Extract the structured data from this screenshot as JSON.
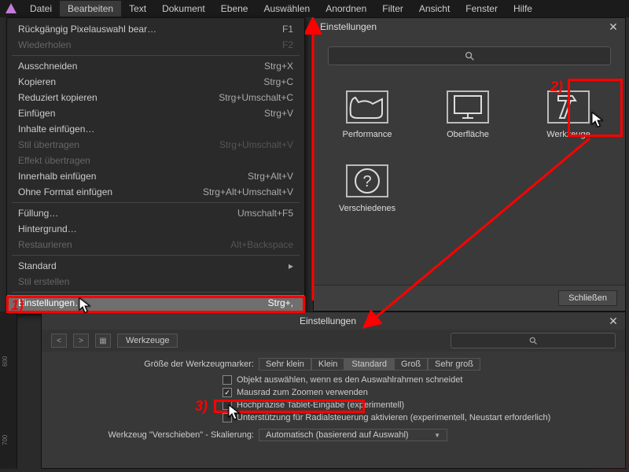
{
  "menubar": {
    "items": [
      "Datei",
      "Bearbeiten",
      "Text",
      "Dokument",
      "Ebene",
      "Auswählen",
      "Anordnen",
      "Filter",
      "Ansicht",
      "Fenster",
      "Hilfe"
    ],
    "active_index": 1
  },
  "dropdown": {
    "rows": [
      {
        "label": "Rückgängig Pixelauswahl bear…",
        "shortcut": "F1"
      },
      {
        "label": "Wiederholen",
        "shortcut": "F2",
        "disabled": true
      },
      {
        "sep": true
      },
      {
        "label": "Ausschneiden",
        "shortcut": "Strg+X"
      },
      {
        "label": "Kopieren",
        "shortcut": "Strg+C"
      },
      {
        "label": "Reduziert kopieren",
        "shortcut": "Strg+Umschalt+C"
      },
      {
        "label": "Einfügen",
        "shortcut": "Strg+V"
      },
      {
        "label": "Inhalte einfügen…",
        "shortcut": ""
      },
      {
        "label": "Stil übertragen",
        "shortcut": "Strg+Umschalt+V",
        "disabled": true
      },
      {
        "label": "Effekt übertragen",
        "shortcut": "",
        "disabled": true
      },
      {
        "label": "Innerhalb einfügen",
        "shortcut": "Strg+Alt+V"
      },
      {
        "label": "Ohne Format einfügen",
        "shortcut": "Strg+Alt+Umschalt+V"
      },
      {
        "sep": true
      },
      {
        "label": "Füllung…",
        "shortcut": "Umschalt+F5"
      },
      {
        "label": "Hintergrund…",
        "shortcut": ""
      },
      {
        "label": "Restaurieren",
        "shortcut": "Alt+Backspace",
        "disabled": true
      },
      {
        "sep": true
      },
      {
        "label": "Standard",
        "shortcut": "",
        "chevron": true
      },
      {
        "label": "Stil erstellen",
        "shortcut": "",
        "disabled": true
      },
      {
        "sep": true
      },
      {
        "label": "Einstellungen…",
        "shortcut": "Strg+,",
        "selected": true
      }
    ]
  },
  "dlg1": {
    "title": "Einstellungen",
    "categories": [
      {
        "name": "Performance",
        "icon": "cat"
      },
      {
        "name": "Oberfläche",
        "icon": "monitor"
      },
      {
        "name": "Werkzeuge",
        "icon": "hammer"
      },
      {
        "name": "Verschiedenes",
        "icon": "question"
      }
    ],
    "close_label": "Schließen"
  },
  "dlg2": {
    "title": "Einstellungen",
    "crumb": "Werkzeuge",
    "marker_label": "Größe der Werkzeugmarker:",
    "sizes": [
      "Sehr klein",
      "Klein",
      "Standard",
      "Groß",
      "Sehr groß"
    ],
    "size_selected": 2,
    "checks": [
      {
        "label": "Objekt auswählen, wenn es den Auswahlrahmen schneidet",
        "checked": false
      },
      {
        "label": "Mausrad zum Zoomen verwenden",
        "checked": true
      },
      {
        "label": "Hochpräzise Tablet-Eingabe (experimentell)",
        "checked": false
      },
      {
        "label": "Unterstützung für Radialsteuerung aktivieren (experimentell, Neustart erforderlich)",
        "checked": false
      }
    ],
    "move_label": "Werkzeug \"Verschieben\" - Skalierung:",
    "move_value": "Automatisch (basierend auf Auswahl)"
  },
  "annotations": {
    "step1": "1)",
    "step2": "2)",
    "step3": "3)"
  },
  "ruler_ticks": [
    "600",
    "700"
  ]
}
